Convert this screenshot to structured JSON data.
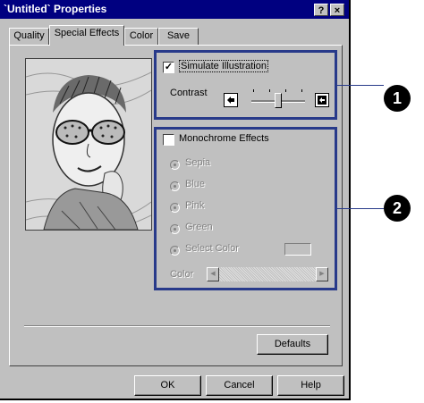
{
  "window": {
    "title": "`Untitled` Properties",
    "help_btn": "?",
    "close_btn": "×"
  },
  "tabs": [
    {
      "label": "Quality"
    },
    {
      "label": "Special Effects",
      "active": true
    },
    {
      "label": "Color"
    },
    {
      "label": "Save"
    }
  ],
  "illustration": {
    "simulate_label": "Simulate Illustration",
    "simulate_checked": true,
    "contrast_label": "Contrast",
    "contrast_level": 0.5
  },
  "monochrome": {
    "label": "Monochrome Effects",
    "checked": false,
    "options": [
      "Sepia",
      "Blue",
      "Pink",
      "Green",
      "Select Color"
    ],
    "color_label": "Color"
  },
  "buttons": {
    "defaults": "Defaults",
    "ok": "OK",
    "cancel": "Cancel",
    "help": "Help"
  },
  "callouts": [
    "1",
    "2"
  ],
  "colors": {
    "titlebar": "#000080",
    "callout": "#283a8a",
    "dialog": "#c0c0c0"
  }
}
